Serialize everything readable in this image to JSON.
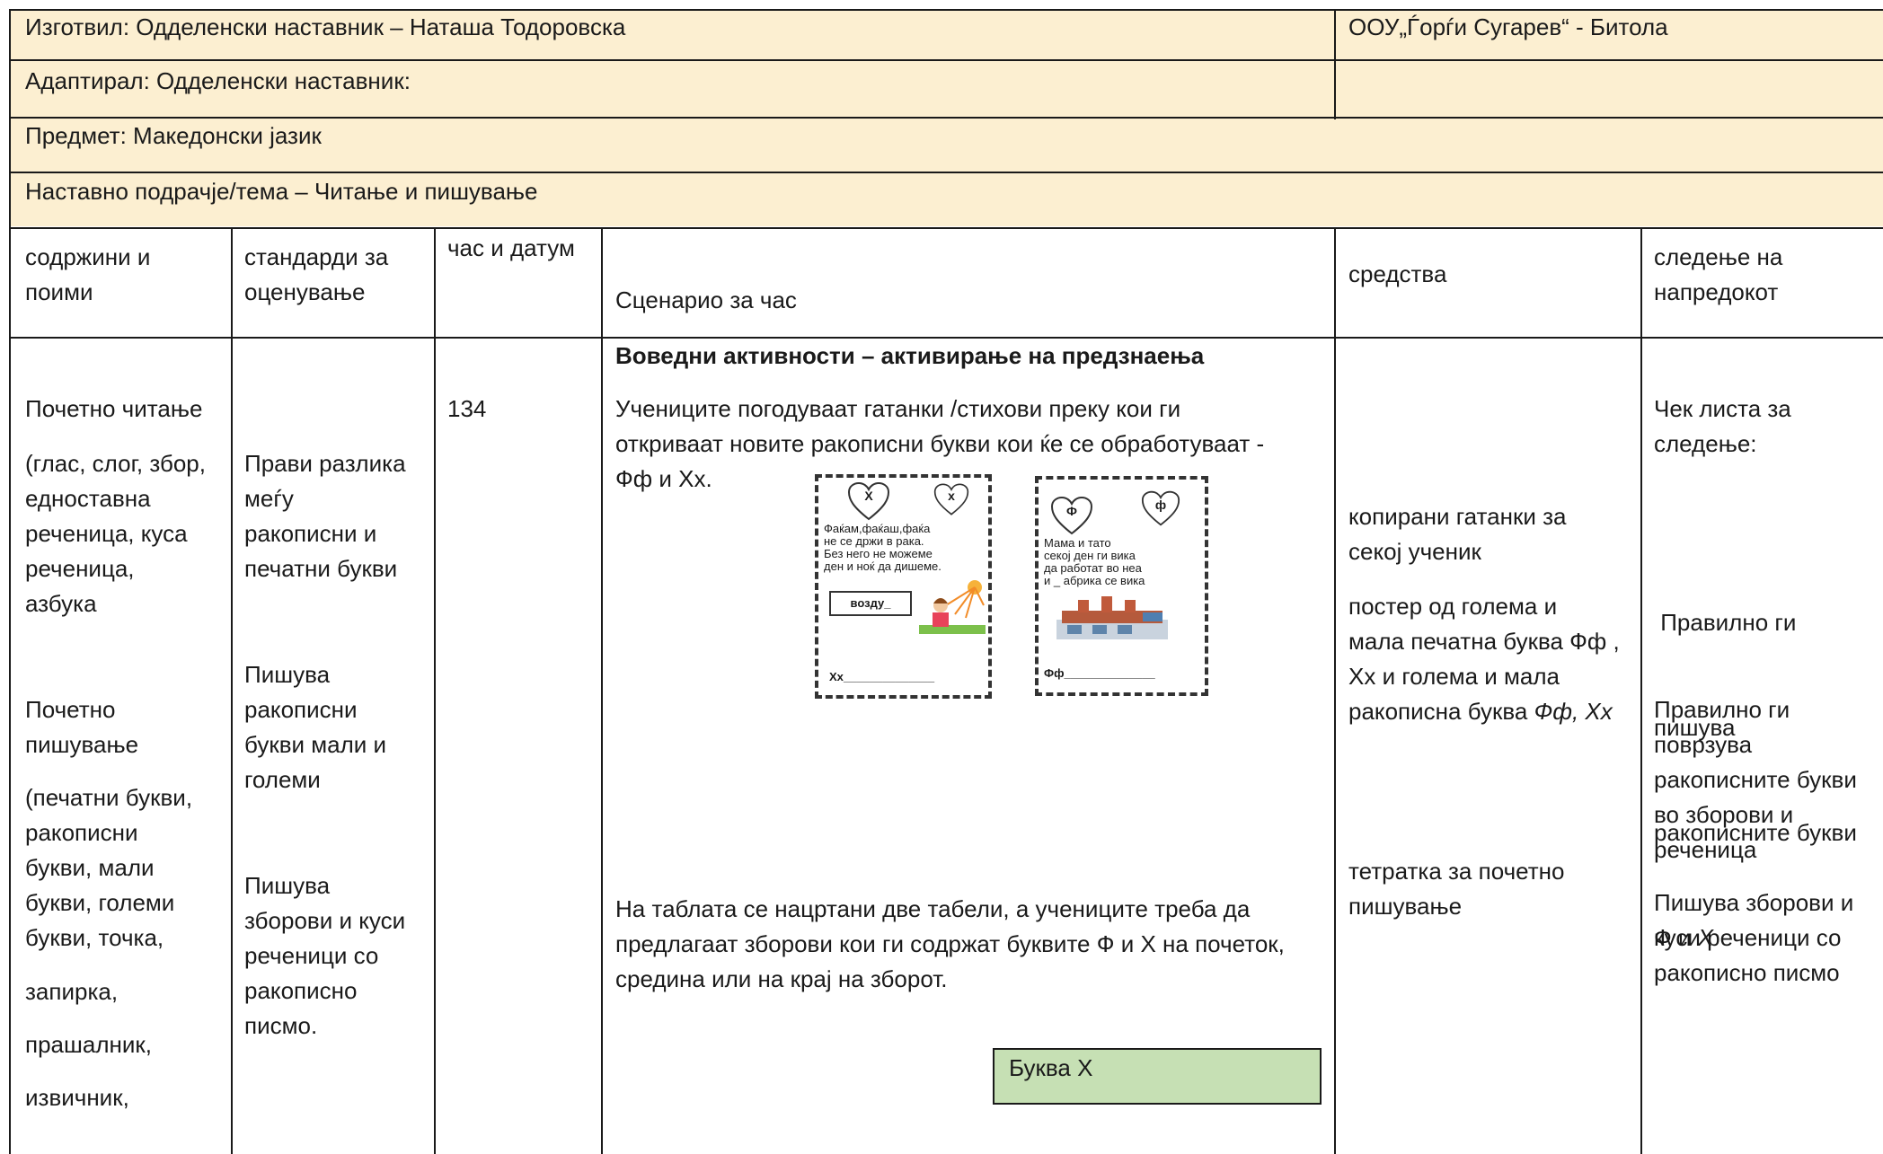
{
  "header": {
    "prepared_by": "Изготвил: Одделенски наставник – Наташа Тодоровска",
    "school": "ООУ„Ѓорѓи Сугарев“ - Битола",
    "adapted_by": "Адаптирал: Одделенски наставник:",
    "subject": "Предмет: Македонски јазик",
    "topic": "Наставно подрачје/тема – Читање и пишување"
  },
  "columns": {
    "content": [
      "содржини и",
      "поими"
    ],
    "standards": [
      "стандарди за",
      "оценување"
    ],
    "hour_date": "час и датум",
    "scenario": "Сценарио за час",
    "resources": "средства",
    "progress": [
      "следење на",
      "напредокот"
    ]
  },
  "content_col": {
    "reading_title": "Почетно читање",
    "reading_items": [
      "(глас, слог, збор,",
      "едноставна",
      "реченица, куса",
      "реченица,",
      "азбука"
    ],
    "writing_title": [
      "Почетно",
      "пишување"
    ],
    "writing_items": [
      "(печатни букви,",
      "ракописни",
      "букви, мали",
      "букви, големи",
      "букви, точка,"
    ],
    "comma": "запирка,",
    "question_mark": "прашалник,",
    "exclamation": "извичник,"
  },
  "standards_col": {
    "s1": [
      "Прави разлика",
      "меѓу",
      "ракописни и",
      "печатни букви"
    ],
    "s2": [
      "Пишува",
      "ракописни",
      "букви мали и",
      "големи"
    ],
    "s3": [
      "Пишува",
      "зборови и куси",
      "реченици со",
      "ракописно",
      "писмо."
    ]
  },
  "hour_col": {
    "number": "134"
  },
  "scenario_col": {
    "heading": "Воведни активности – активирање на предзнаења",
    "para1": [
      "Учениците погодуваат гатанки /стихови преку кои ги",
      "откриваат новите ракописни букви кои ќе се обработуваат -",
      "Фф и Хх."
    ],
    "para2": [
      "На таблата се  нацртани две  табели, а учениците треба да",
      "предлагаат зборови кои ги содржат буквите Ф и Х на почеток,",
      "средина или на крај на зборот."
    ],
    "table_label": "Буква Х",
    "card1": {
      "heart_big": "Х",
      "heart_small": "х",
      "riddle": [
        "Фаќам,фаќаш,фаќа",
        "не се држи в рака.",
        "Без него не можеме",
        "ден и ноќ да дишеме."
      ],
      "answer": "возду_",
      "line": "Хх______________"
    },
    "card2": {
      "heart_big": "Ф",
      "heart_small": "ф",
      "riddle": [
        "Мама и тато",
        "секој ден ги вика",
        "да работат во неа",
        "и _ абрика се вика"
      ],
      "line": "Фф______________"
    }
  },
  "resources_col": {
    "r1": [
      "копирани гатанки за",
      "секој ученик"
    ],
    "r2_lines": [
      "постер од голема и",
      "мала печатна буква Фф ,",
      "Хх и голема и мала"
    ],
    "r2_last_plain": "ракописна буква ",
    "r2_last_italic": "Фф, Хх",
    "r3": [
      "тетратка за почетно",
      "пишување"
    ]
  },
  "progress_col": {
    "checklist": [
      "Чек листа за",
      "следење:"
    ],
    "p1_lines": [
      " Правилно ги",
      "пишува",
      "ракописните букви"
    ],
    "p1_last_plain": "Ф и ",
    "p1_last_italic": "Х",
    "p2": [
      "Правилно ги",
      "поврзува",
      "ракописните букви",
      "во зборови и",
      "реченица"
    ],
    "p3": [
      "Пишува зборови и",
      "куси реченици со",
      "ракописно писмо"
    ]
  },
  "colors": {
    "header_fill": "#fcefd1",
    "table_fill": "#c6e0b4",
    "border": "#1a1a1a"
  }
}
